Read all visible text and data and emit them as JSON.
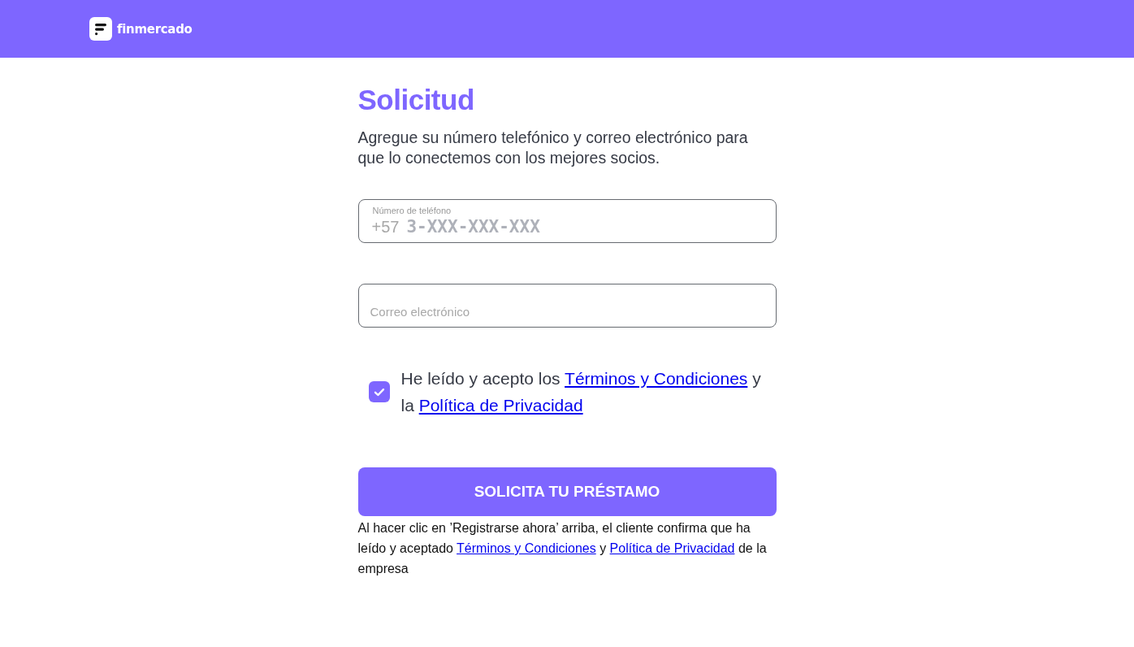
{
  "header": {
    "brand": "finmercado"
  },
  "form": {
    "title": "Solicitud",
    "subtitle": "Agregue su número telefónico y correo electrónico para que lo conectemos con los mejores socios.",
    "phone": {
      "label": "Número de teléfono",
      "prefix": "+57",
      "placeholder": "3-XXX-XXX-XXX"
    },
    "email": {
      "placeholder": "Correo electrónico"
    },
    "consent": {
      "checked": true,
      "parts": [
        {
          "kind": "text",
          "text": "He leído y acepto los "
        },
        {
          "kind": "link",
          "text": "Términos y Condiciones"
        },
        {
          "kind": "text",
          "text": " y la "
        },
        {
          "kind": "link",
          "text": "Política de Privacidad"
        }
      ]
    },
    "submit": "SOLICITA TU PRÉSTAMO",
    "disclaimer": [
      {
        "kind": "text",
        "text": "Al hacer clic en ’Registrarse ahora’ arriba, el cliente confirma que ha leído y aceptado "
      },
      {
        "kind": "link",
        "text": "Términos y Condiciones"
      },
      {
        "kind": "text",
        "text": " y "
      },
      {
        "kind": "link",
        "text": "Política de Privacidad"
      },
      {
        "kind": "text",
        "text": " de la empresa"
      }
    ]
  }
}
